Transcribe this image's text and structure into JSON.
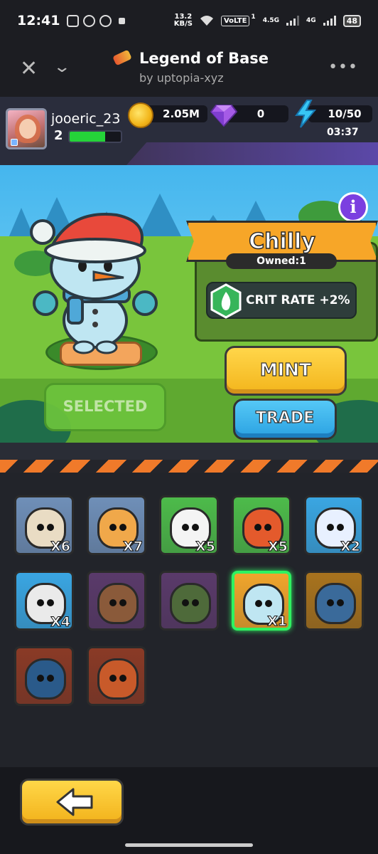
{
  "status_bar": {
    "time": "12:41",
    "speed_value": "13.2",
    "speed_unit": "KB/S",
    "volte": "VoLTE",
    "volte_sup": "1",
    "net1": "4.5G",
    "net2": "4G",
    "battery": "48"
  },
  "app_header": {
    "title": "Legend of Base",
    "subtitle": "by uptopia-xyz",
    "more": "•••"
  },
  "player": {
    "username": "jooeric_23",
    "level": "2",
    "xp_fraction": 0.7
  },
  "resources": {
    "coins": "2.05M",
    "gems": "0",
    "energy": "10/50",
    "energy_timer": "03:37"
  },
  "hero": {
    "name": "Chilly",
    "owned": "Owned:1",
    "stat": "CRIT RATE +2%",
    "mint_label": "MINT",
    "trade_label": "TRADE",
    "selected_label": "SELECTED",
    "info_label": "i"
  },
  "inventory": [
    {
      "name": "cat",
      "count": "X6",
      "bg": "#6f8fb8",
      "color": "#e9dcc4"
    },
    {
      "name": "shiba",
      "count": "X7",
      "bg": "#6f8fb8",
      "color": "#f0a84a"
    },
    {
      "name": "duck",
      "count": "X5",
      "bg": "#4dbb4a",
      "color": "#f4f4f4"
    },
    {
      "name": "crab",
      "count": "X5",
      "bg": "#4dbb4a",
      "color": "#e45a2c"
    },
    {
      "name": "penguin",
      "count": "X2",
      "bg": "#3aa6e2",
      "color": "#e8f0ff"
    },
    {
      "name": "zebra",
      "count": "X4",
      "bg": "#3aa6e2",
      "color": "#eaeaea"
    },
    {
      "name": "reindeer",
      "count": "",
      "bg": "#5a3a6a",
      "color": "#8a5a3a"
    },
    {
      "name": "crocodile",
      "count": "",
      "bg": "#5a3a6a",
      "color": "#4e6a3a"
    },
    {
      "name": "chilly",
      "count": "X1",
      "bg": "#f0a52c",
      "color": "#bfe6f2"
    },
    {
      "name": "pirate-blob",
      "count": "",
      "bg": "#a8731e",
      "color": "#3a6a9a"
    },
    {
      "name": "robot",
      "count": "",
      "bg": "#8a3a26",
      "color": "#2a5a8a"
    },
    {
      "name": "dragon",
      "count": "",
      "bg": "#8a3a26",
      "color": "#c85a2a"
    }
  ],
  "colors": {
    "accent_orange": "#f7a628",
    "accent_blue": "#2ba2e2",
    "xp_green": "#25d339",
    "selected_border": "#2ff261"
  },
  "icons": {
    "coin": "coin-icon",
    "gem": "gem-icon",
    "energy": "lightning-icon",
    "stat": "crit-flame-icon",
    "back": "arrow-left-icon"
  }
}
